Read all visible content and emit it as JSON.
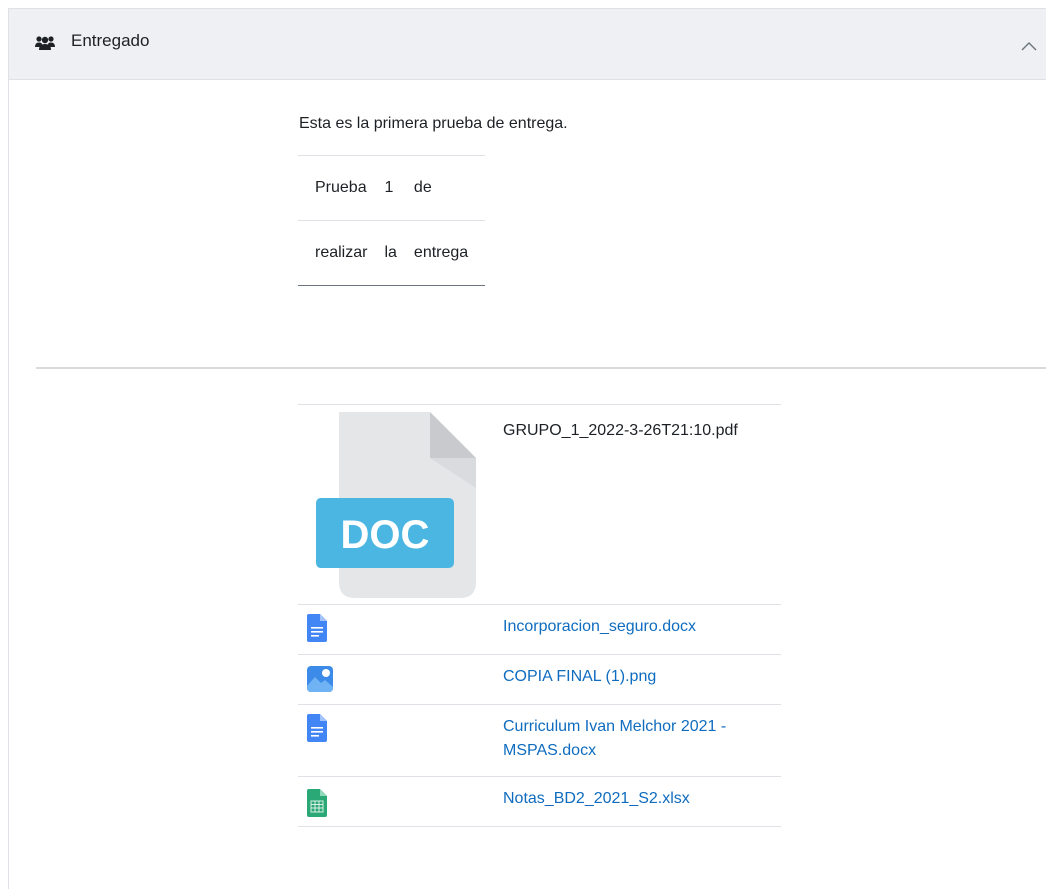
{
  "section": {
    "title": "Entregado",
    "header_icon": "users-icon",
    "toggle_icon": "chevron-up-icon"
  },
  "submission": {
    "description": "Esta es la primera prueba de entrega.",
    "table": [
      [
        "Prueba",
        "1",
        "de"
      ],
      [
        "realizar",
        "la",
        "entrega"
      ]
    ]
  },
  "files": [
    {
      "name": "GRUPO_1_2022-3-26T21:10.pdf",
      "icon": "doc-preview-icon",
      "preview_label": "DOC"
    },
    {
      "name": "Incorporacion_seguro.docx",
      "icon": "document-icon",
      "color": "#4285f4"
    },
    {
      "name": "COPIA FINAL (1).png",
      "icon": "image-icon",
      "color": "#3d8be8"
    },
    {
      "name": "Curriculum Ivan Melchor 2021 - MSPAS.docx",
      "icon": "document-icon",
      "color": "#4285f4"
    },
    {
      "name": "Notas_BD2_2021_S2.xlsx",
      "icon": "spreadsheet-icon",
      "color": "#2aa876"
    }
  ]
}
